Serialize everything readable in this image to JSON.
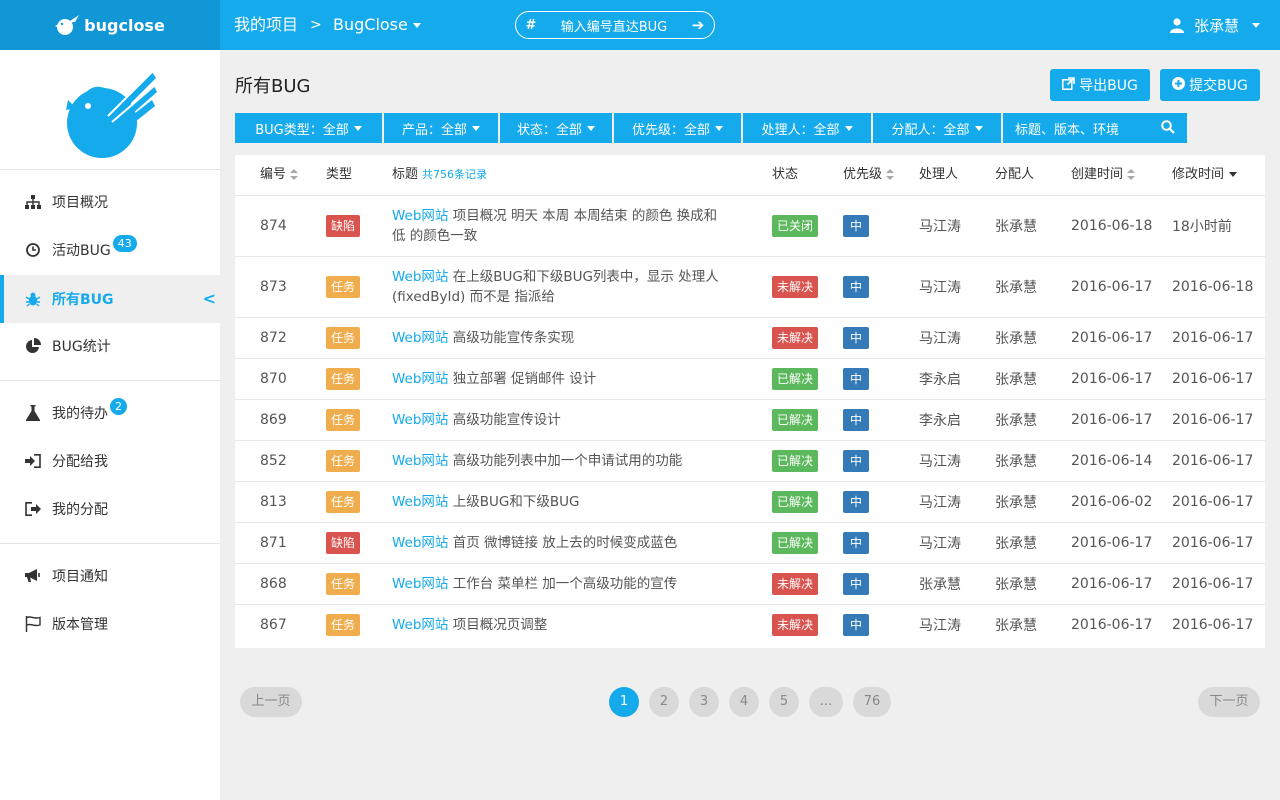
{
  "topbar": {
    "logo_text": "bugclose",
    "project_crumb": "我的项目",
    "crumb_sep": ">",
    "current_project": "BugClose",
    "jump_hash": "#",
    "jump_placeholder": "输入编号直达BUG",
    "jump_arrow": "➔",
    "user_name": "张承慧"
  },
  "sidebar": {
    "items": [
      {
        "label": "项目概况",
        "icon": "sitemap-icon"
      },
      {
        "label": "活动BUG",
        "icon": "clock-icon",
        "badge": "43"
      },
      {
        "label": "所有BUG",
        "icon": "bug-icon",
        "active": true
      },
      {
        "label": "BUG统计",
        "icon": "pie-chart-icon"
      },
      {
        "label": "我的待办",
        "icon": "flask-icon",
        "badge": "2"
      },
      {
        "label": "分配给我",
        "icon": "sign-in-icon"
      },
      {
        "label": "我的分配",
        "icon": "sign-out-icon"
      },
      {
        "label": "项目通知",
        "icon": "bullhorn-icon"
      },
      {
        "label": "版本管理",
        "icon": "flag-icon"
      }
    ]
  },
  "main": {
    "title": "所有BUG",
    "export_label": "导出BUG",
    "submit_label": "提交BUG",
    "filters": [
      {
        "label": "BUG类型：全部"
      },
      {
        "label": "产品：全部"
      },
      {
        "label": "状态：全部"
      },
      {
        "label": "优先级：全部"
      },
      {
        "label": "处理人：全部"
      },
      {
        "label": "分配人：全部"
      }
    ],
    "search_placeholder": "标题、版本、环境"
  },
  "table": {
    "headers": {
      "id": "编号",
      "type": "类型",
      "title": "标题",
      "count": "共756条记录",
      "status": "状态",
      "priority": "优先级",
      "handler": "处理人",
      "assigner": "分配人",
      "created": "创建时间",
      "modified": "修改时间"
    },
    "rows": [
      {
        "id": "874",
        "type": "缺陷",
        "site": "Web网站",
        "title": " 项目概况 明天 本周 本周结束 的颜色 换成和 低 的颜色一致",
        "status": "已关闭",
        "priority": "中",
        "handler": "马江涛",
        "assigner": "张承慧",
        "created": "2016-06-18",
        "modified": "18小时前"
      },
      {
        "id": "873",
        "type": "任务",
        "site": "Web网站",
        "title": " 在上级BUG和下级BUG列表中，显示 处理人(fixedById) 而不是 指派给",
        "status": "未解决",
        "priority": "中",
        "handler": "马江涛",
        "assigner": "张承慧",
        "created": "2016-06-17",
        "modified": "2016-06-18"
      },
      {
        "id": "872",
        "type": "任务",
        "site": "Web网站",
        "title": " 高级功能宣传条实现",
        "status": "未解决",
        "priority": "中",
        "handler": "马江涛",
        "assigner": "张承慧",
        "created": "2016-06-17",
        "modified": "2016-06-17"
      },
      {
        "id": "870",
        "type": "任务",
        "site": "Web网站",
        "title": " 独立部署  促销邮件 设计",
        "status": "已解决",
        "priority": "中",
        "handler": "李永启",
        "assigner": "张承慧",
        "created": "2016-06-17",
        "modified": "2016-06-17"
      },
      {
        "id": "869",
        "type": "任务",
        "site": "Web网站",
        "title": " 高级功能宣传设计",
        "status": "已解决",
        "priority": "中",
        "handler": "李永启",
        "assigner": "张承慧",
        "created": "2016-06-17",
        "modified": "2016-06-17"
      },
      {
        "id": "852",
        "type": "任务",
        "site": "Web网站",
        "title": " 高级功能列表中加一个申请试用的功能",
        "status": "已解决",
        "priority": "中",
        "handler": "马江涛",
        "assigner": "张承慧",
        "created": "2016-06-14",
        "modified": "2016-06-17"
      },
      {
        "id": "813",
        "type": "任务",
        "site": "Web网站",
        "title": " 上级BUG和下级BUG",
        "status": "已解决",
        "priority": "中",
        "handler": "马江涛",
        "assigner": "张承慧",
        "created": "2016-06-02",
        "modified": "2016-06-17"
      },
      {
        "id": "871",
        "type": "缺陷",
        "site": "Web网站",
        "title": " 首页 微博链接 放上去的时候变成蓝色",
        "status": "已解决",
        "priority": "中",
        "handler": "马江涛",
        "assigner": "张承慧",
        "created": "2016-06-17",
        "modified": "2016-06-17"
      },
      {
        "id": "868",
        "type": "任务",
        "site": "Web网站",
        "title": " 工作台 菜单栏 加一个高级功能的宣传",
        "status": "未解决",
        "priority": "中",
        "handler": "张承慧",
        "assigner": "张承慧",
        "created": "2016-06-17",
        "modified": "2016-06-17"
      },
      {
        "id": "867",
        "type": "任务",
        "site": "Web网站",
        "title": " 项目概况页调整",
        "status": "未解决",
        "priority": "中",
        "handler": "马江涛",
        "assigner": "张承慧",
        "created": "2016-06-17",
        "modified": "2016-06-17"
      }
    ]
  },
  "pager": {
    "prev": "上一页",
    "next": "下一页",
    "pages": [
      "1",
      "2",
      "3",
      "4",
      "5",
      "…",
      "76"
    ],
    "current": "1"
  },
  "colors": {
    "accent": "#14aaeb",
    "defect": "#d9534f",
    "task": "#f0ad4e",
    "closed": "#5cb85c",
    "resolved": "#5cb85c",
    "unresolved": "#d9534f",
    "priority_mid": "#337ab7"
  }
}
